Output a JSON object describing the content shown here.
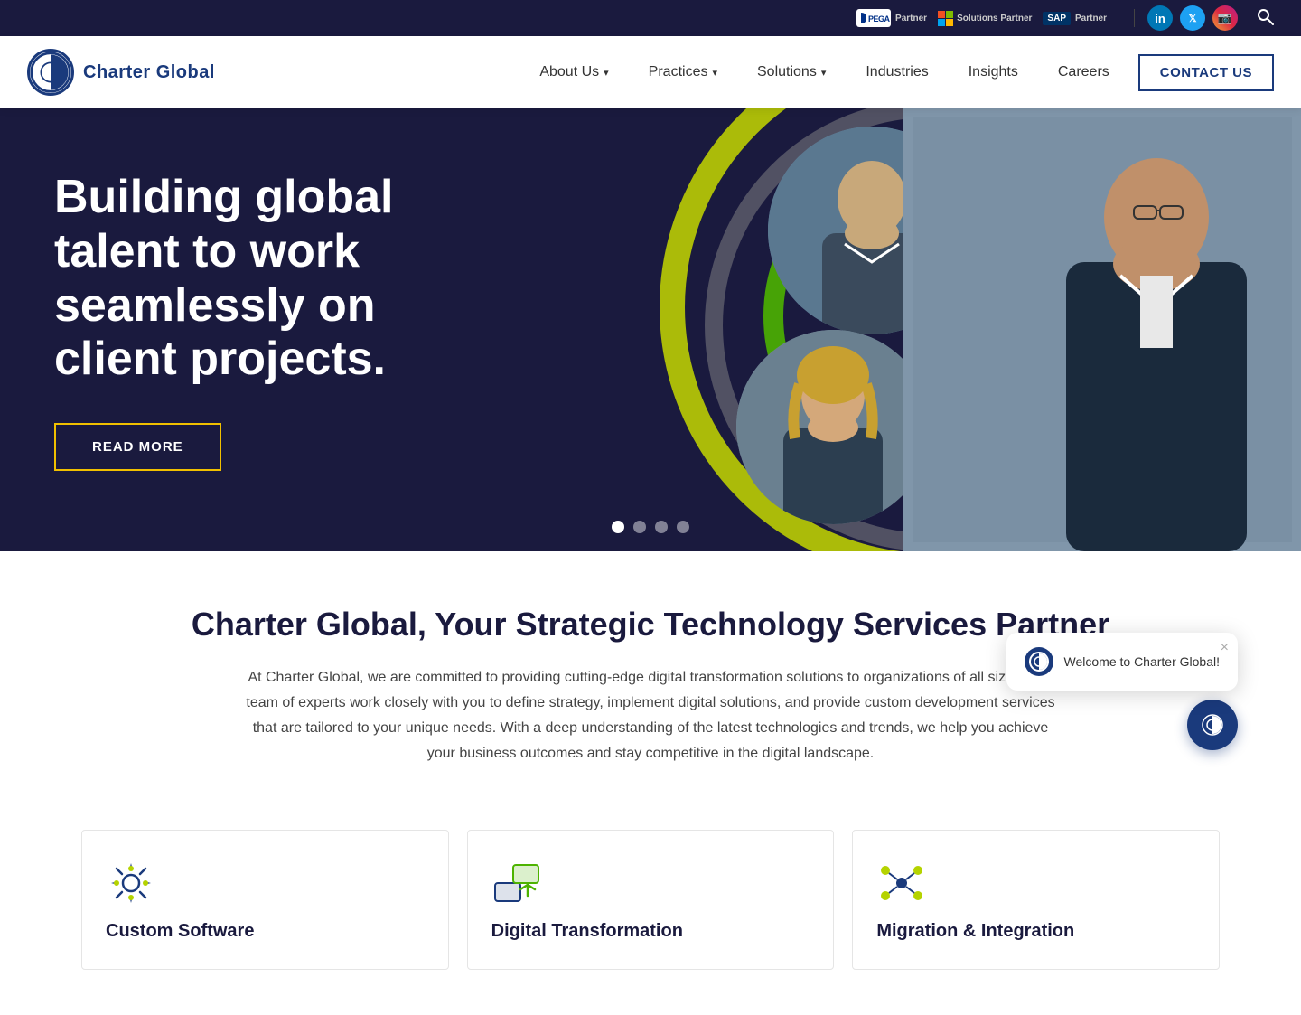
{
  "topbar": {
    "partners": [
      {
        "name": "PEGA Partner",
        "type": "pega"
      },
      {
        "name": "Microsoft Solutions Partner",
        "type": "microsoft"
      },
      {
        "name": "SAP Partner",
        "type": "sap"
      }
    ],
    "socials": [
      {
        "name": "LinkedIn",
        "id": "linkedin",
        "icon": "in"
      },
      {
        "name": "Twitter/X",
        "id": "twitter",
        "icon": "𝕏"
      },
      {
        "name": "Instagram",
        "id": "instagram",
        "icon": "📷"
      }
    ],
    "search_label": "Search"
  },
  "header": {
    "logo_text": "Charter Global",
    "logo_tm": "™",
    "nav_items": [
      {
        "label": "About Us",
        "has_dropdown": true
      },
      {
        "label": "Practices",
        "has_dropdown": true
      },
      {
        "label": "Solutions",
        "has_dropdown": true
      },
      {
        "label": "Industries",
        "has_dropdown": false
      },
      {
        "label": "Insights",
        "has_dropdown": false
      },
      {
        "label": "Careers",
        "has_dropdown": false
      }
    ],
    "contact_btn": "CONTACT US"
  },
  "hero": {
    "title": "Building global talent to work seamlessly on client projects.",
    "cta_label": "READ MORE",
    "slides": [
      {
        "active": true
      },
      {
        "active": false
      },
      {
        "active": false
      },
      {
        "active": false
      }
    ]
  },
  "intro": {
    "title": "Charter Global, Your Strategic Technology Services Partner",
    "body": "At Charter Global, we are committed to providing cutting-edge digital transformation solutions to organizations of all sizes. Our team of experts work closely with you to define strategy, implement digital solutions, and provide custom development services that are tailored to your unique needs. With a deep understanding of the latest technologies and trends, we help you achieve your business outcomes and stay competitive in the digital landscape."
  },
  "services": [
    {
      "title": "Custom Software",
      "icon_type": "gear",
      "icon_label": "custom-software-icon"
    },
    {
      "title": "Digital Transformation",
      "icon_type": "transform",
      "icon_label": "digital-transformation-icon"
    },
    {
      "title": "Migration & Integration",
      "icon_type": "migrate",
      "icon_label": "migration-icon"
    }
  ],
  "chat": {
    "welcome_text": "Welcome to Charter Global!",
    "close_label": "×"
  }
}
